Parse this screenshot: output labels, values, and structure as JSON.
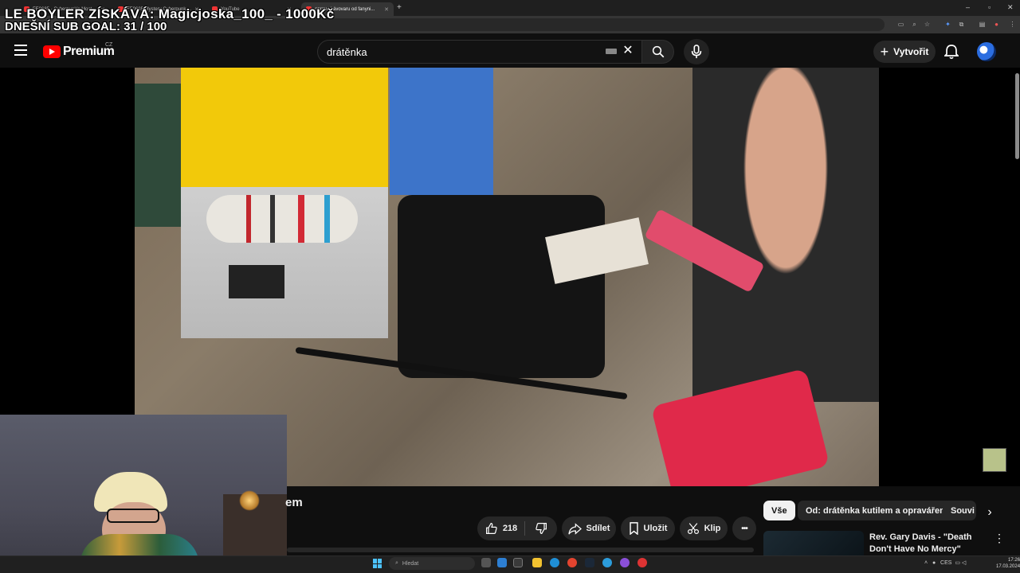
{
  "browser": {
    "tabs": [
      {
        "label": "FE0685 - Cyberpunk's Most ..."
      },
      {
        "label": "FE0685 Mystery Cyberpunk ..."
      },
      {
        "label": "YouTube"
      },
      {
        "label": "oprava kávovaru od fanyni..."
      }
    ],
    "new_tab": "+"
  },
  "overlay": {
    "line1": "LE BOYLER ZÍSKÁVÁ: Magicjoska_100_ - 1000Kč",
    "line2": "DNEŠNÍ SUB GOAL: 31 / 100"
  },
  "header": {
    "logo_text": "Premium",
    "logo_region": "CZ",
    "search_value": "drátěnka",
    "create_label": "Vytvořit"
  },
  "video": {
    "title_fragment": "em"
  },
  "actions": {
    "like_count": "218",
    "share_label": "Sdílet",
    "save_label": "Uložit",
    "clip_label": "Klip",
    "more_label": "•••"
  },
  "chips": [
    {
      "label": "Vše",
      "selected": true
    },
    {
      "label": "Od: drátěnka kutilem a opravářem",
      "selected": false
    },
    {
      "label": "Souvi",
      "selected": false
    }
  ],
  "recommendation": {
    "title": "Rev. Gary Davis - \"Death Don't Have No Mercy\" South of ..."
  },
  "taskbar": {
    "search_placeholder": "Hledat",
    "tray_text": "CES",
    "time": "17:26",
    "date": "17.03.2024"
  },
  "colors": {
    "brand_red": "#ff0000",
    "background": "#0f0f0f",
    "chip_selected": "#f1f1f1"
  },
  "icons": {
    "menu": "hamburger-icon",
    "search": "search-icon",
    "mic": "microphone-icon",
    "bell": "bell-icon",
    "like": "thumbs-up-icon",
    "dislike": "thumbs-down-icon",
    "share": "share-arrow-icon",
    "save": "bookmark-icon",
    "clip": "scissors-icon"
  }
}
